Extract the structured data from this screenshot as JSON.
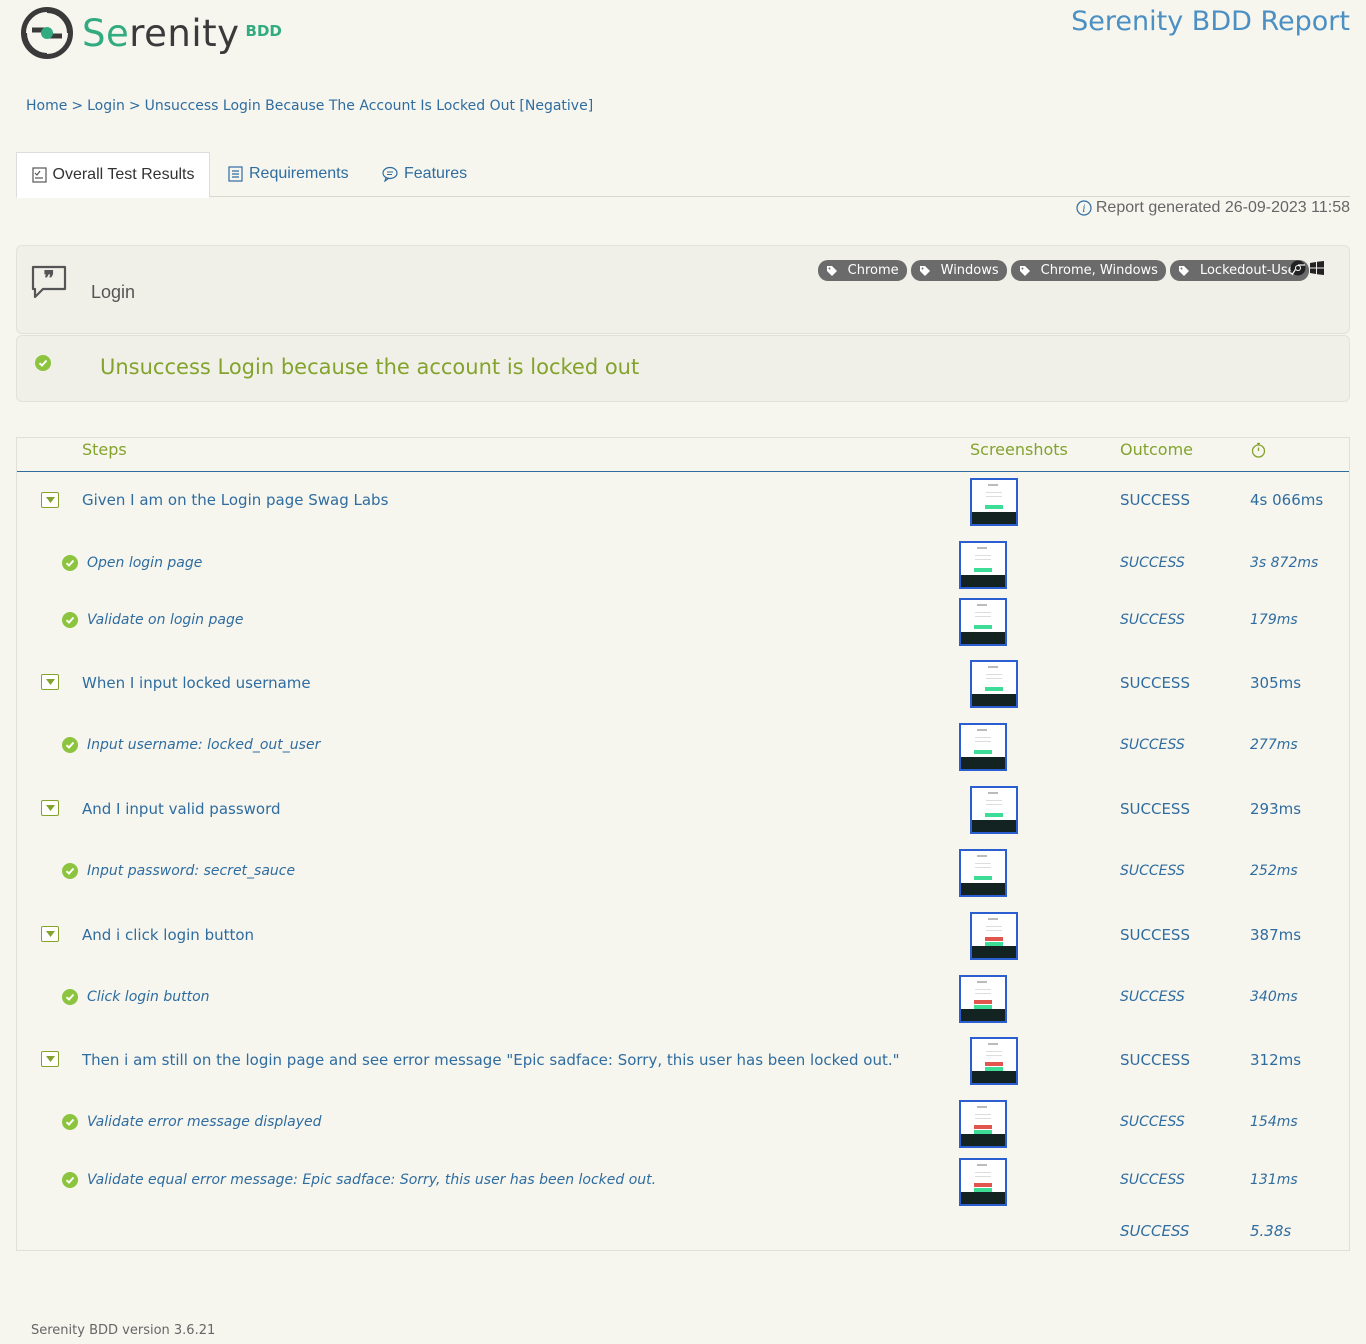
{
  "header": {
    "logo_text_prefix": "Se",
    "logo_text_rest": "renity",
    "logo_badge": "BDD",
    "report_title": "Serenity BDD Report"
  },
  "breadcrumb": {
    "items": [
      "Home",
      "Login",
      "Unsuccess Login Because The Account Is Locked Out [Negative]"
    ],
    "separator": ">"
  },
  "tabs": [
    {
      "label": "Overall Test Results",
      "active": true
    },
    {
      "label": "Requirements",
      "active": false
    },
    {
      "label": "Features",
      "active": false
    }
  ],
  "report_generated": "Report generated 26-09-2023 11:58",
  "feature": {
    "name": "Login",
    "tags": [
      "Chrome",
      "Windows",
      "Chrome, Windows",
      "Lockedout-User"
    ]
  },
  "scenario": {
    "title": "Unsuccess Login because the account is locked out"
  },
  "steps_table": {
    "headers": {
      "steps": "Steps",
      "screenshots": "Screenshots",
      "outcome": "Outcome"
    },
    "rows": [
      {
        "text": "Given I am on the Login page Swag Labs",
        "outcome": "SUCCESS",
        "duration": "4s 066ms"
      },
      {
        "text": "Open login page",
        "outcome": "SUCCESS",
        "duration": "3s 872ms"
      },
      {
        "text": "Validate on login page",
        "outcome": "SUCCESS",
        "duration": "179ms"
      },
      {
        "text": "When I input locked username",
        "outcome": "SUCCESS",
        "duration": "305ms"
      },
      {
        "text": "Input username: locked_out_user",
        "outcome": "SUCCESS",
        "duration": "277ms"
      },
      {
        "text": "And I input valid password",
        "outcome": "SUCCESS",
        "duration": "293ms"
      },
      {
        "text": "Input password: secret_sauce",
        "outcome": "SUCCESS",
        "duration": "252ms"
      },
      {
        "text": "And i click login button",
        "outcome": "SUCCESS",
        "duration": "387ms"
      },
      {
        "text": "Click login button",
        "outcome": "SUCCESS",
        "duration": "340ms"
      },
      {
        "text": "Then i am still on the login page and see error message \"Epic sadface: Sorry, this user has been locked out.\"",
        "outcome": "SUCCESS",
        "duration": "312ms"
      },
      {
        "text": "Validate error message displayed",
        "outcome": "SUCCESS",
        "duration": "154ms"
      },
      {
        "text": "Validate equal error message: Epic sadface: Sorry, this user has been locked out.",
        "outcome": "SUCCESS",
        "duration": "131ms"
      }
    ],
    "total": {
      "outcome": "SUCCESS",
      "duration": "5.38s"
    }
  },
  "footer": "Serenity BDD version 3.6.21",
  "colors": {
    "accent_green": "#83a32c",
    "link_blue": "#2f6c9f",
    "brand_teal": "#33ab81",
    "success_check": "#8cc43f"
  }
}
